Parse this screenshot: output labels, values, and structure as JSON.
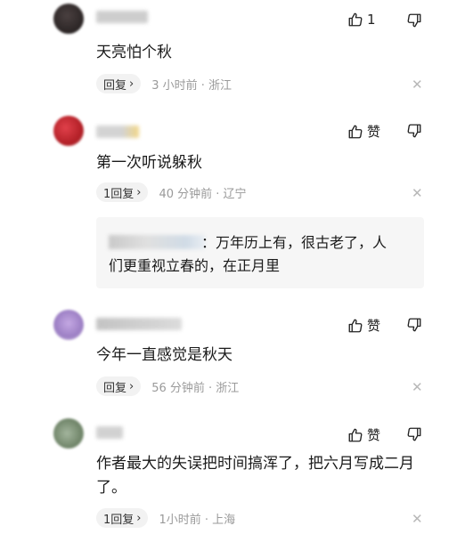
{
  "comments": [
    {
      "like_label": "1",
      "text": "天亮怕个秋",
      "reply_label": "回复",
      "meta": "3 小时前 · 浙江",
      "avatar_color": "#3a3332"
    },
    {
      "like_label": "赞",
      "text": "第一次听说躲秋",
      "reply_label": "1回复",
      "meta": "40 分钟前 · 辽宁",
      "avatar_color": "#c62a2f",
      "sub_reply": {
        "text_line1": "：万年历上有，很古老了，人",
        "text_line2": "们更重视立春的，在正月里"
      }
    },
    {
      "like_label": "赞",
      "text": "今年一直感觉是秋天",
      "reply_label": "回复",
      "meta": "56 分钟前 · 浙江",
      "avatar_color": "#b597d3"
    },
    {
      "like_label": "赞",
      "text": "作者最大的失误把时间搞浑了，把六月写成二月了。",
      "reply_label": "1回复",
      "meta": "1小时前 · 上海",
      "avatar_color": "#8ea187"
    }
  ],
  "icons": {
    "like": "thumbs-up-icon",
    "dislike": "thumbs-down-icon",
    "reply_chevron": "chevron-right-icon",
    "dismiss": "close-icon"
  }
}
